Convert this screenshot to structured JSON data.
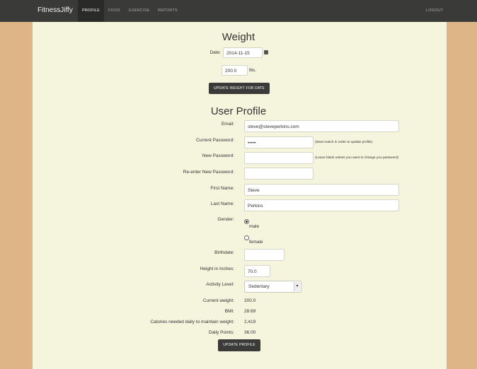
{
  "nav": {
    "brand": "FitnessJiffy",
    "items": [
      "PROFILE",
      "FOOD",
      "EXERCISE",
      "REPORTS"
    ],
    "logout": "LOGOUT"
  },
  "weight": {
    "title": "Weight",
    "date_label": "Date:",
    "date_value": "2014-11-15",
    "weight_value": "200.0",
    "unit": "lbs.",
    "update_button": "UPDATE WEIGHT FOR DATE"
  },
  "profile": {
    "title": "User Profile",
    "email_label": "Email:",
    "email_value": "steve@steveperkins.com",
    "current_password_label": "Current Password:",
    "current_password_value": "•••••",
    "current_password_note": "(Must match in order to update profile)",
    "new_password_label": "New Password:",
    "new_password_note": "(Leave blank unless you want to change you password)",
    "reenter_password_label": "Re-enter New Password:",
    "first_name_label": "First Name:",
    "first_name_value": "Steve",
    "last_name_label": "Last Name:",
    "last_name_value": "Perkins",
    "gender_label": "Gender:",
    "gender_options": [
      "male",
      "female"
    ],
    "gender_selected": "male",
    "birthdate_label": "Birthdate:",
    "height_label": "Height in Inches:",
    "height_value": "70.0",
    "activity_label": "Activity Level:",
    "activity_value": "Sedentary",
    "current_weight_label": "Current weight:",
    "current_weight_value": "200.0",
    "bmi_label": "BMI:",
    "bmi_value": "28.69",
    "calories_label": "Calories needed daily to maintain weight:",
    "calories_value": "2,419",
    "daily_points_label": "Daily Points:",
    "daily_points_value": "36.00",
    "update_button": "UPDATE PROFILE"
  }
}
